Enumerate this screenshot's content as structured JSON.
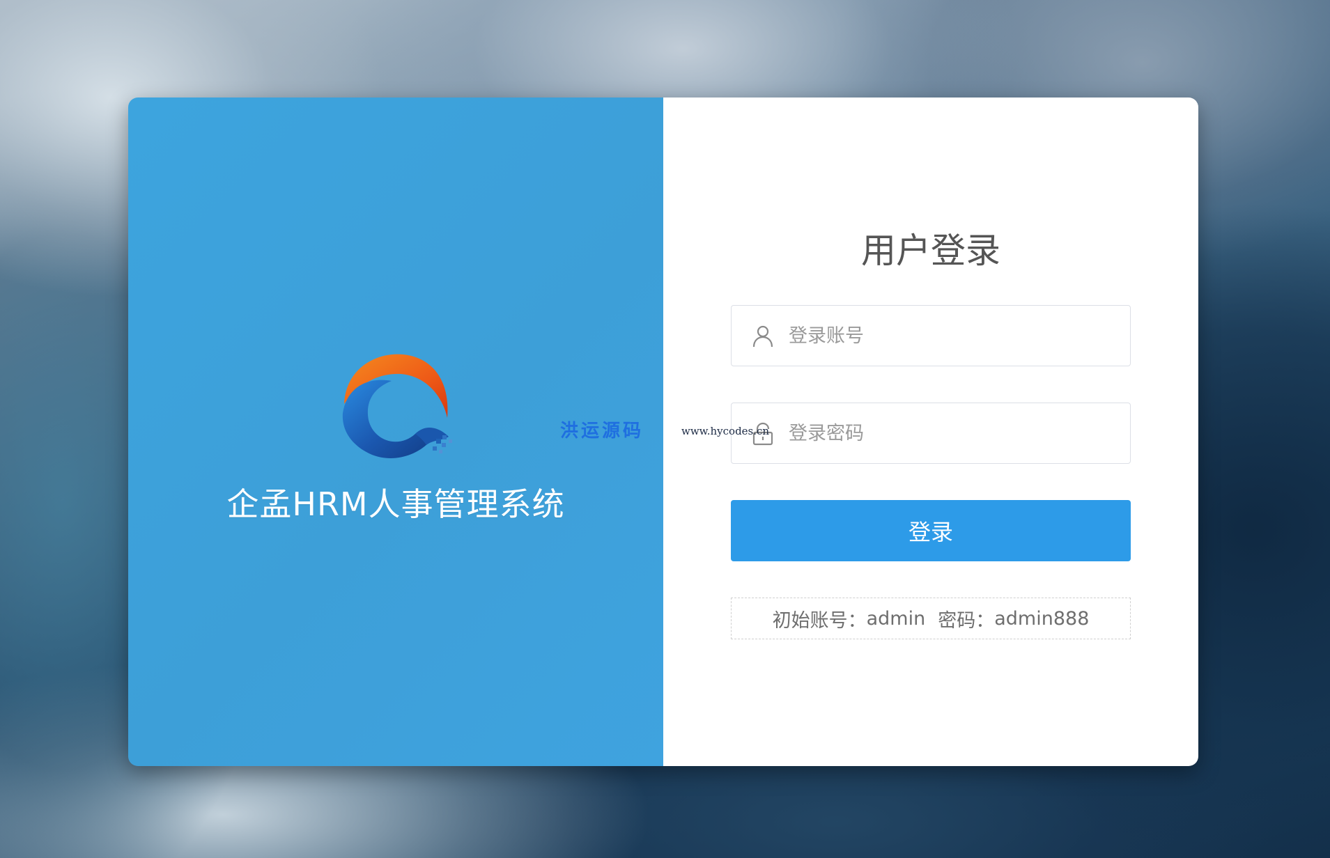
{
  "brand": {
    "system_title": "企孟HRM人事管理系统",
    "logo_colors": {
      "orange": "#f26a1b",
      "blue": "#1d5fb0"
    }
  },
  "login": {
    "title": "用户登录",
    "account_placeholder": "登录账号",
    "password_placeholder": "登录密码",
    "submit_label": "登录",
    "hint": {
      "account_label": "初始账号：",
      "account_value": "admin",
      "password_label": "密码：",
      "password_value": "admin888"
    },
    "account_icon": "user-icon",
    "password_icon": "lock-icon"
  },
  "watermark": {
    "name": "洪运源码",
    "url": "www.hycodes.cn"
  },
  "colors": {
    "left_panel": "#3da4de",
    "button": "#2d9be8"
  }
}
